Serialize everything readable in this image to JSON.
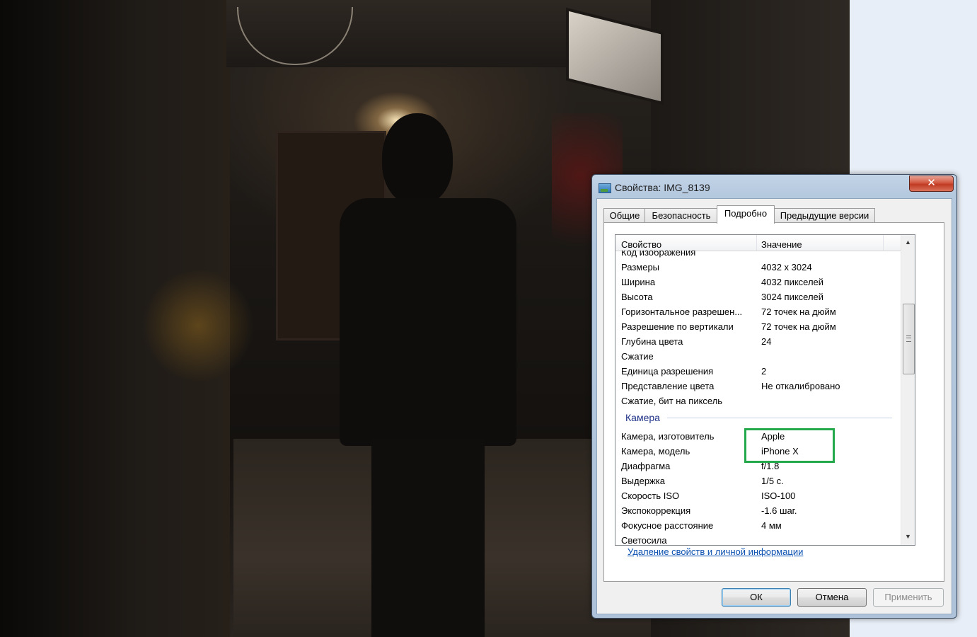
{
  "dialog": {
    "title": "Свойства: IMG_8139",
    "close_glyph": "✕"
  },
  "tabs": [
    {
      "label": "Общие",
      "active": false
    },
    {
      "label": "Безопасность",
      "active": false
    },
    {
      "label": "Подробно",
      "active": true
    },
    {
      "label": "Предыдущие версии",
      "active": false
    }
  ],
  "table": {
    "columns": [
      "Свойство",
      "Значение"
    ],
    "rows": [
      {
        "key": "Код изображения",
        "value": ""
      },
      {
        "key": "Размеры",
        "value": "4032 x 3024"
      },
      {
        "key": "Ширина",
        "value": "4032 пикселей"
      },
      {
        "key": "Высота",
        "value": "3024 пикселей"
      },
      {
        "key": "Горизонтальное разрешен...",
        "value": "72 точек на дюйм"
      },
      {
        "key": "Разрешение по вертикали",
        "value": "72 точек на дюйм"
      },
      {
        "key": "Глубина цвета",
        "value": "24"
      },
      {
        "key": "Сжатие",
        "value": ""
      },
      {
        "key": "Единица разрешения",
        "value": "2"
      },
      {
        "key": "Представление цвета",
        "value": "Не откалибровано"
      },
      {
        "key": "Сжатие, бит на пиксель",
        "value": ""
      }
    ],
    "group_label": "Камера",
    "camera_rows": [
      {
        "key": "Камера, изготовитель",
        "value": "Apple"
      },
      {
        "key": "Камера, модель",
        "value": "iPhone X"
      },
      {
        "key": "Диафрагма",
        "value": "f/1.8"
      },
      {
        "key": "Выдержка",
        "value": "1/5 с."
      },
      {
        "key": "Скорость ISO",
        "value": "ISO-100"
      },
      {
        "key": "Экспокоррекция",
        "value": "-1.6 шаг."
      },
      {
        "key": "Фокусное расстояние",
        "value": "4 мм"
      },
      {
        "key": "Светосила",
        "value": ""
      }
    ]
  },
  "scrollbar": {
    "up": "▲",
    "down": "▼"
  },
  "link": "Удаление свойств и личной информации",
  "buttons": {
    "ok": "ОК",
    "cancel": "Отмена",
    "apply": "Применить"
  },
  "colors": {
    "highlight": "#23a84b",
    "link": "#0a50b0",
    "group": "#1e3287"
  }
}
